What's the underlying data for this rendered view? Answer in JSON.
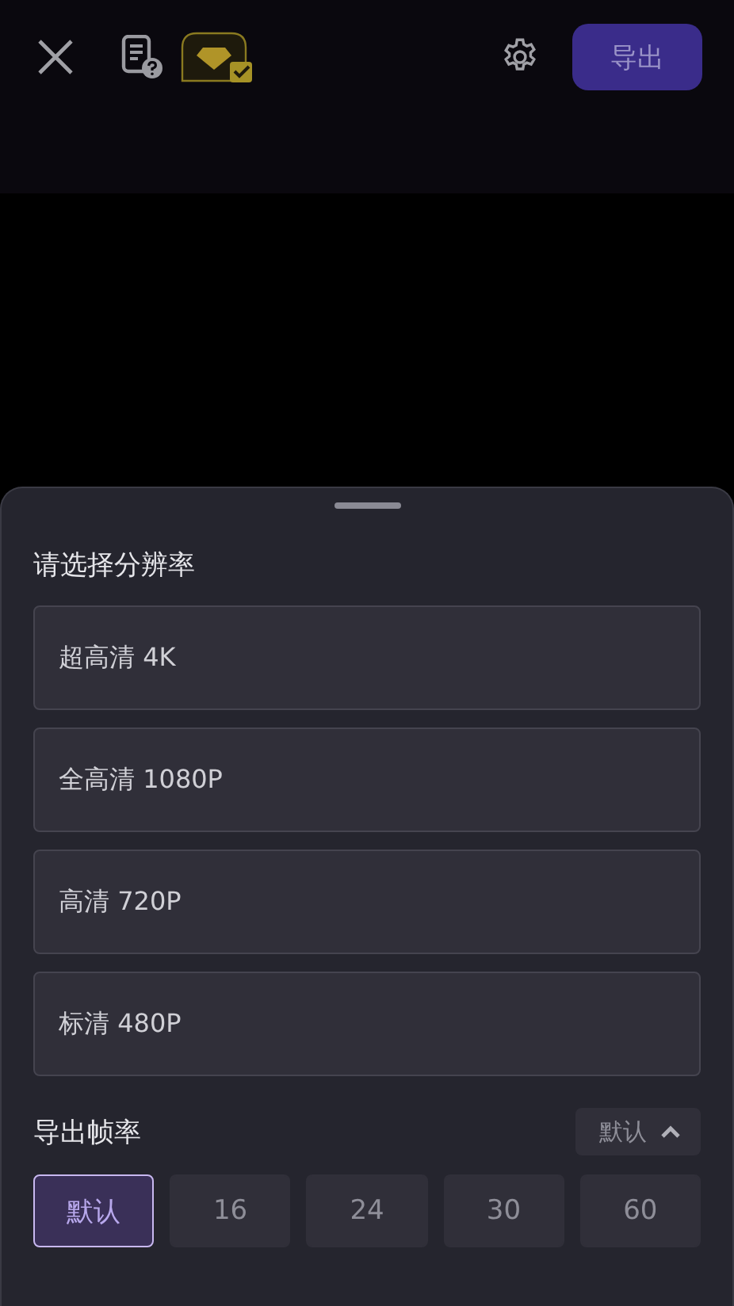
{
  "toolbar": {
    "export_button": "导出"
  },
  "resolution": {
    "title": "请选择分辨率",
    "options": [
      {
        "label": "超高清 4K",
        "selected": false
      },
      {
        "label": "全高清 1080P",
        "selected": false
      },
      {
        "label": "高清 720P",
        "selected": false
      },
      {
        "label": "标清 480P",
        "selected": false
      }
    ]
  },
  "frame_rate": {
    "title": "导出帧率",
    "dropdown": "默认",
    "expanded": true,
    "options": [
      {
        "label": "默认",
        "selected": true
      },
      {
        "label": "16",
        "selected": false
      },
      {
        "label": "24",
        "selected": false
      },
      {
        "label": "30",
        "selected": false
      },
      {
        "label": "60",
        "selected": false
      }
    ]
  }
}
